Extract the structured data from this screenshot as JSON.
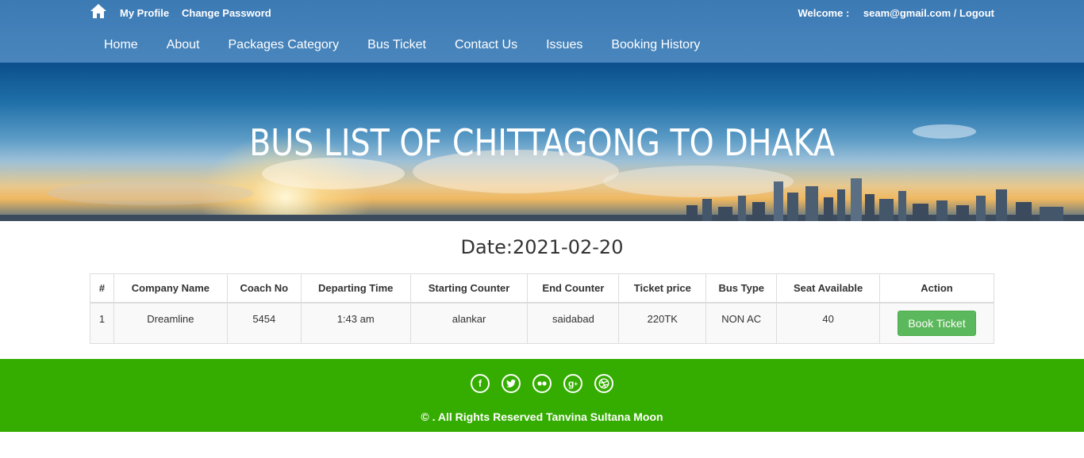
{
  "header": {
    "links": {
      "my_profile": "My Profile",
      "change_password": "Change Password"
    },
    "welcome_label": "Welcome :",
    "user_text": "seam@gmail.com / Logout"
  },
  "nav": {
    "items": [
      "Home",
      "About",
      "Packages Category",
      "Bus Ticket",
      "Contact Us",
      "Issues",
      "Booking History"
    ]
  },
  "banner": {
    "title": "BUS LIST OF CHITTAGONG TO DHAKA"
  },
  "date_text": "Date:2021-02-20",
  "table": {
    "headers": [
      "#",
      "Company Name",
      "Coach No",
      "Departing Time",
      "Starting Counter",
      "End Counter",
      "Ticket price",
      "Bus Type",
      "Seat Available",
      "Action"
    ],
    "rows": [
      {
        "num": "1",
        "company": "Dreamline",
        "coach": "5454",
        "time": "1:43 am",
        "start": "alankar",
        "end": "saidabad",
        "price": "220TK",
        "type": "NON AC",
        "seats": "40",
        "action": "Book Ticket"
      }
    ]
  },
  "footer": {
    "social_icons": [
      "facebook-icon",
      "twitter-icon",
      "flickr-icon",
      "google-plus-icon",
      "dribbble-icon"
    ],
    "copyright": "© . All Rights Reserved Tanvina Sultana Moon"
  },
  "colors": {
    "header": "#3c7ab4",
    "footer": "#34ad00",
    "button": "#5cb85c"
  }
}
